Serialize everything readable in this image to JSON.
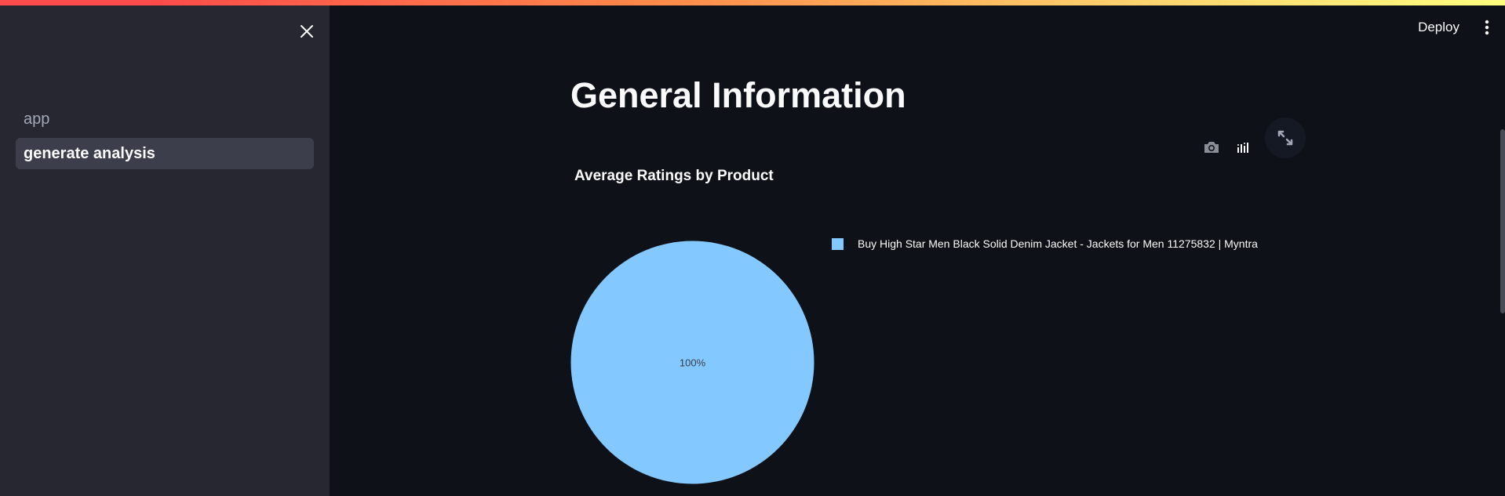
{
  "sidebar": {
    "close_icon": "close-icon",
    "items": [
      {
        "label": "app",
        "active": false
      },
      {
        "label": "generate analysis",
        "active": true
      }
    ]
  },
  "header": {
    "deploy_label": "Deploy",
    "menu_icon": "kebab-menu-icon"
  },
  "main": {
    "title": "General Information"
  },
  "toolbar": {
    "icons": [
      "camera-icon",
      "plotly-logo-icon",
      "fullscreen-icon"
    ]
  },
  "colors": {
    "background": "#0e1117",
    "sidebar": "#262730",
    "pie_slice": "#83c9ff",
    "active_item": "#3d3e4b"
  },
  "chart_data": {
    "type": "pie",
    "title": "Average Ratings by Product",
    "categories": [
      "Buy High Star Men Black Solid Denim Jacket  - Jackets for Men 11275832 | Myntra"
    ],
    "values": [
      100
    ],
    "slice_labels": [
      "100%"
    ],
    "colors": [
      "#83c9ff"
    ],
    "legend_position": "right"
  }
}
